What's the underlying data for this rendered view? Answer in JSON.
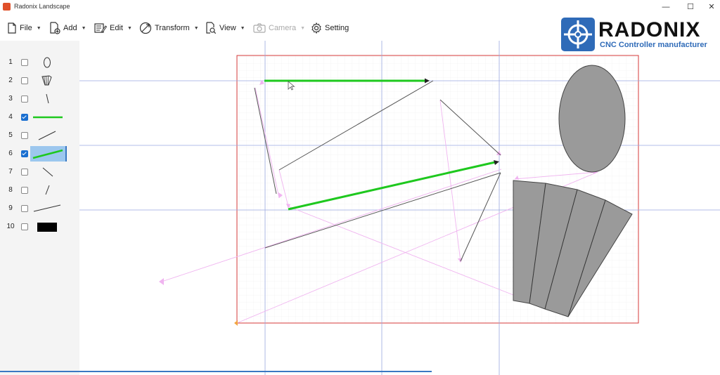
{
  "window": {
    "title": "Radonix Landscape",
    "minimize": "—",
    "maximize": "☐",
    "close": "✕"
  },
  "toolbar": {
    "items": [
      {
        "label": "File",
        "icon": "file-icon"
      },
      {
        "label": "Add",
        "icon": "add-file-icon"
      },
      {
        "label": "Edit",
        "icon": "edit-icon"
      },
      {
        "label": "Transform",
        "icon": "transform-icon"
      },
      {
        "label": "View",
        "icon": "view-icon"
      },
      {
        "label": "Camera",
        "icon": "camera-icon",
        "disabled": true
      },
      {
        "label": "Setting",
        "icon": "gear-icon"
      }
    ],
    "dropdown_glyph": "▼"
  },
  "logo": {
    "word": "RADONIX",
    "tagline": "CNC Controller manufacturer",
    "color": "#2f6bb8"
  },
  "layers": [
    {
      "num": "1",
      "checked": false,
      "shape": "ellipse-icon"
    },
    {
      "num": "2",
      "checked": false,
      "shape": "fan-icon"
    },
    {
      "num": "3",
      "checked": false,
      "shape": "line-icon"
    },
    {
      "num": "4",
      "checked": true,
      "shape": "green-line-icon"
    },
    {
      "num": "5",
      "checked": false,
      "shape": "line-icon"
    },
    {
      "num": "6",
      "checked": true,
      "shape": "green-line-icon",
      "selected": true
    },
    {
      "num": "7",
      "checked": false,
      "shape": "line-icon"
    },
    {
      "num": "8",
      "checked": false,
      "shape": "line-icon"
    },
    {
      "num": "9",
      "checked": false,
      "shape": "line-icon"
    },
    {
      "num": "10",
      "checked": false,
      "shape": "black-rect-icon"
    }
  ],
  "colors": {
    "accent": "#1a6fd0",
    "path_green": "#1ec81e",
    "boundary": "#d63a3a",
    "shape_fill": "#9a9a9a",
    "travel": "#f0b4f0"
  }
}
